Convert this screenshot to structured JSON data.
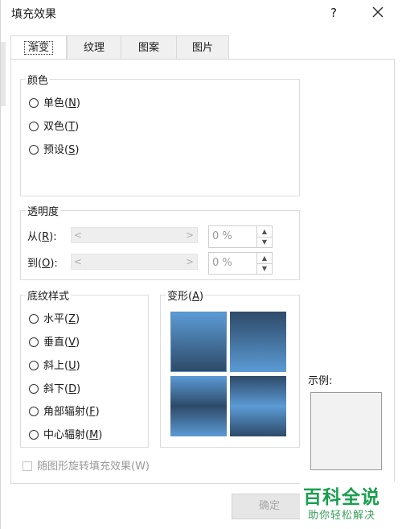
{
  "dialog": {
    "title": "填充效果",
    "help_label": "?",
    "ok_label": "确定"
  },
  "tabs": [
    {
      "label": "渐变"
    },
    {
      "label": "纹理"
    },
    {
      "label": "图案"
    },
    {
      "label": "图片"
    }
  ],
  "colors_group": {
    "label": "颜色",
    "options": [
      {
        "text": "单色(",
        "key": "N"
      },
      {
        "text": "双色(",
        "key": "T"
      },
      {
        "text": "预设(",
        "key": "S"
      }
    ]
  },
  "transparency_group": {
    "label": "透明度",
    "from": {
      "text": "从(",
      "key": "R",
      "suffix": "):",
      "value": "0 %"
    },
    "to": {
      "text": "到(",
      "key": "O",
      "suffix": "):",
      "value": "0 %"
    }
  },
  "shading_group": {
    "label": "底纹样式",
    "options": [
      {
        "text": "水平(",
        "key": "Z"
      },
      {
        "text": "垂直(",
        "key": "V"
      },
      {
        "text": "斜上(",
        "key": "U"
      },
      {
        "text": "斜下(",
        "key": "D"
      },
      {
        "text": "角部辐射(",
        "key": "F"
      },
      {
        "text": "中心辐射(",
        "key": "M"
      }
    ]
  },
  "variants_group": {
    "label_text": "变形(",
    "label_key": "A"
  },
  "rotate_checkbox": {
    "label": "随图形旋转填充效果(W)"
  },
  "preview": {
    "label": "示例:"
  },
  "watermark": {
    "title": "百科全说",
    "subtitle": "助你轻松解决"
  },
  "colors": {
    "gradient_light": "#5b9bd5",
    "gradient_dark": "#2e4a68"
  }
}
